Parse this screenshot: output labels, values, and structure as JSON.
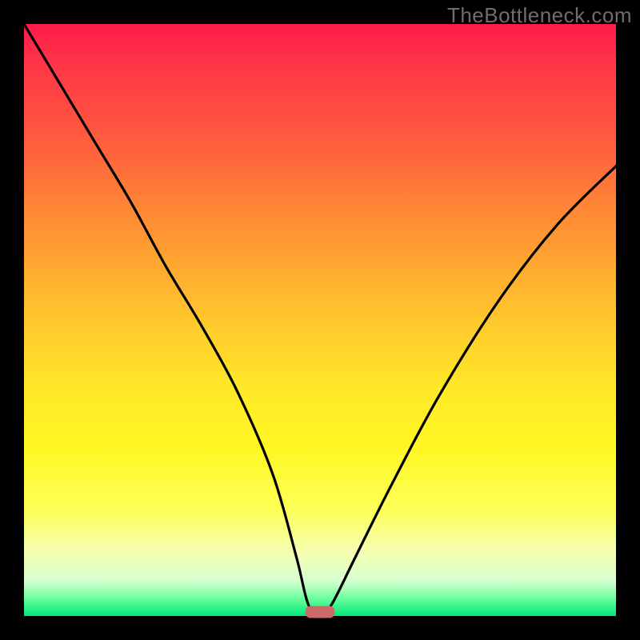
{
  "watermark": "TheBottleneck.com",
  "chart_data": {
    "type": "line",
    "title": "",
    "xlabel": "",
    "ylabel": "",
    "xlim": [
      0,
      100
    ],
    "ylim": [
      0,
      100
    ],
    "background_gradient": {
      "orientation": "vertical",
      "stops": [
        {
          "pos": 0.0,
          "color": "#ff1a4b"
        },
        {
          "pos": 0.3,
          "color": "#ff8236"
        },
        {
          "pos": 0.6,
          "color": "#ffe927"
        },
        {
          "pos": 0.9,
          "color": "#f6ffb0"
        },
        {
          "pos": 1.0,
          "color": "#00e77a"
        }
      ]
    },
    "series": [
      {
        "name": "bottleneck-curve",
        "x": [
          0,
          6,
          12,
          18,
          24,
          30,
          36,
          42,
          46,
          48,
          50,
          52,
          56,
          62,
          70,
          80,
          90,
          100
        ],
        "y": [
          100,
          90,
          80,
          70,
          59,
          49,
          38,
          24,
          10,
          2,
          0,
          2,
          10,
          22,
          37,
          53,
          66,
          76
        ]
      }
    ],
    "marker": {
      "x": 50,
      "y": 0,
      "shape": "rounded-rect",
      "color": "#cc6a6a"
    }
  }
}
